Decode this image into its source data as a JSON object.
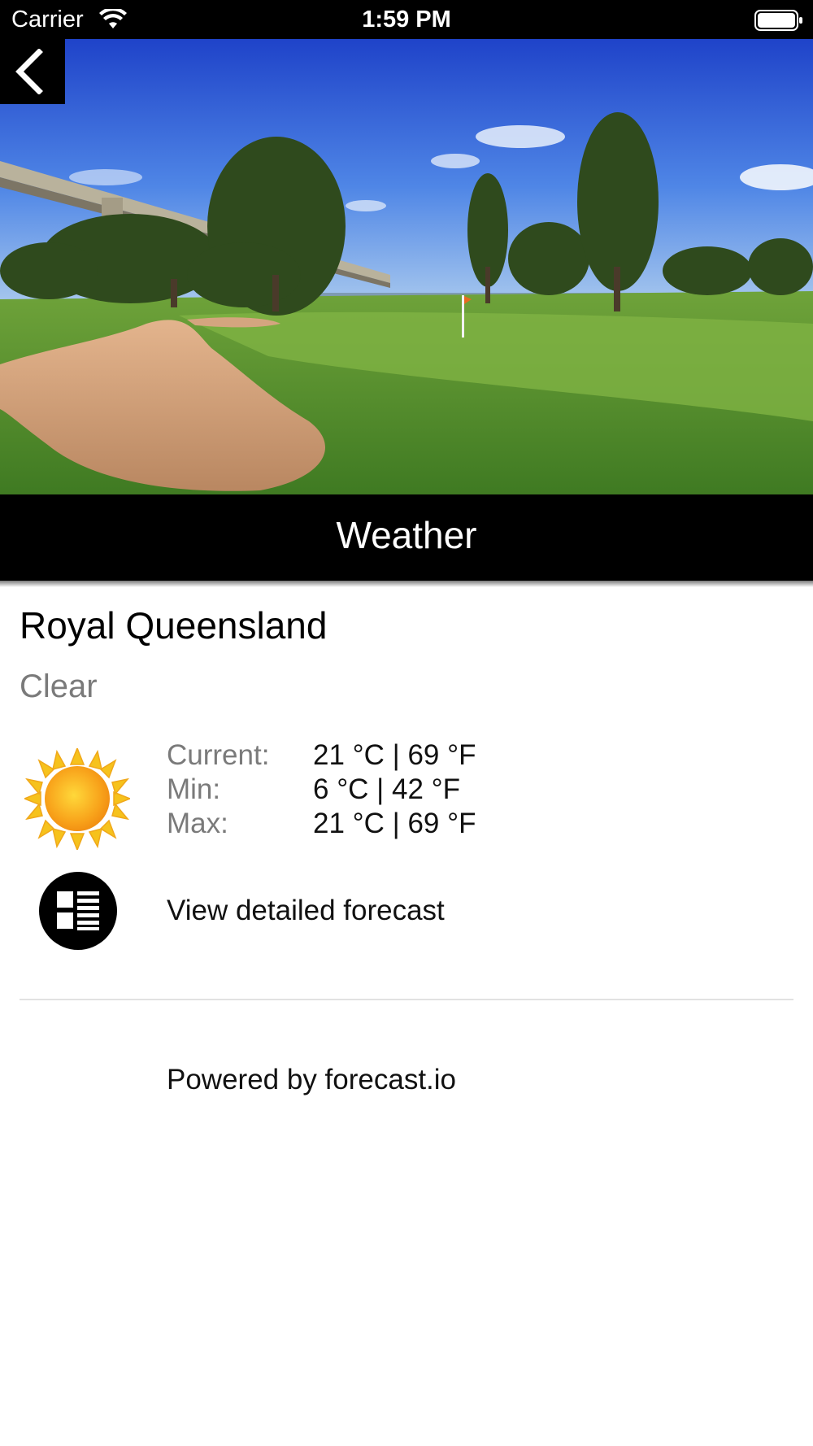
{
  "status_bar": {
    "carrier": "Carrier",
    "time": "1:59 PM"
  },
  "header": {
    "title": "Weather",
    "back_icon": "chevron-left-icon"
  },
  "weather": {
    "location": "Royal Queensland",
    "condition": "Clear",
    "icon": "sun-icon",
    "rows": [
      {
        "label": "Current:",
        "value": "21 °C | 69 °F"
      },
      {
        "label": "Min:",
        "value": "6 °C | 42 °F"
      },
      {
        "label": "Max:",
        "value": "21 °C | 69 °F"
      }
    ],
    "forecast_link": "View detailed forecast",
    "forecast_icon": "list-icon"
  },
  "footer": {
    "powered_by": "Powered by forecast.io"
  },
  "colors": {
    "bar_background": "#000000",
    "muted_text": "#7a7a7a",
    "divider": "#e2e2e2"
  }
}
